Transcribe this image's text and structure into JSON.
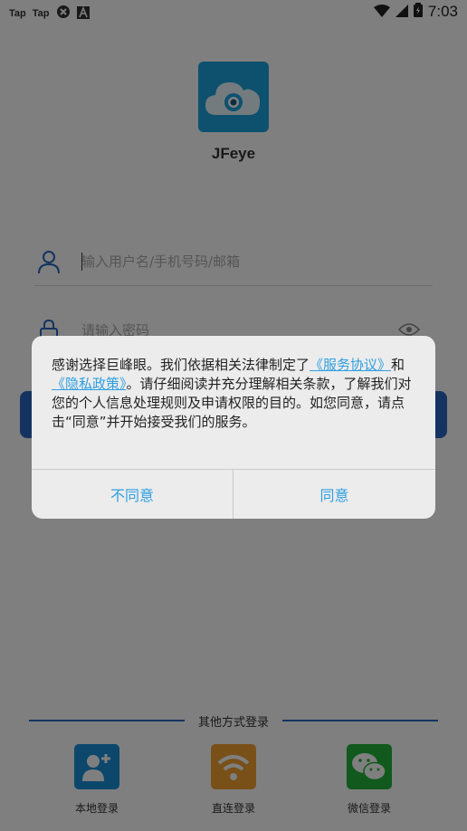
{
  "status_bar": {
    "left_labels": [
      "Tap",
      "Tap"
    ],
    "time": "7:03"
  },
  "app": {
    "name": "JFeye"
  },
  "login_form": {
    "username_placeholder": "输入用户名/手机号码/邮箱",
    "password_placeholder": "请输入密码"
  },
  "other_login": {
    "title": "其他方式登录",
    "options": [
      {
        "label": "本地登录",
        "icon": "local-user-icon",
        "color": "#1a8fd8"
      },
      {
        "label": "直连登录",
        "icon": "wifi-icon",
        "color": "#f0a030"
      },
      {
        "label": "微信登录",
        "icon": "wechat-icon",
        "color": "#23b33a"
      }
    ]
  },
  "privacy_dialog": {
    "text_before": "感谢选择巨峰眼。我们依据相关法律制定了",
    "link_service": "《服务协议》",
    "text_and": "和",
    "link_privacy": "《隐私政策》",
    "text_after": "。请仔细阅读并充分理解相关条款，了解我们对您的个人信息处理规则及申请权限的目的。如您同意，请点击“同意”并开始接受我们的服务。",
    "disagree_label": "不同意",
    "agree_label": "同意"
  },
  "colors": {
    "accent": "#2a66c2",
    "link": "#2e9fe0",
    "logo_bg": "#1aa3dd"
  }
}
